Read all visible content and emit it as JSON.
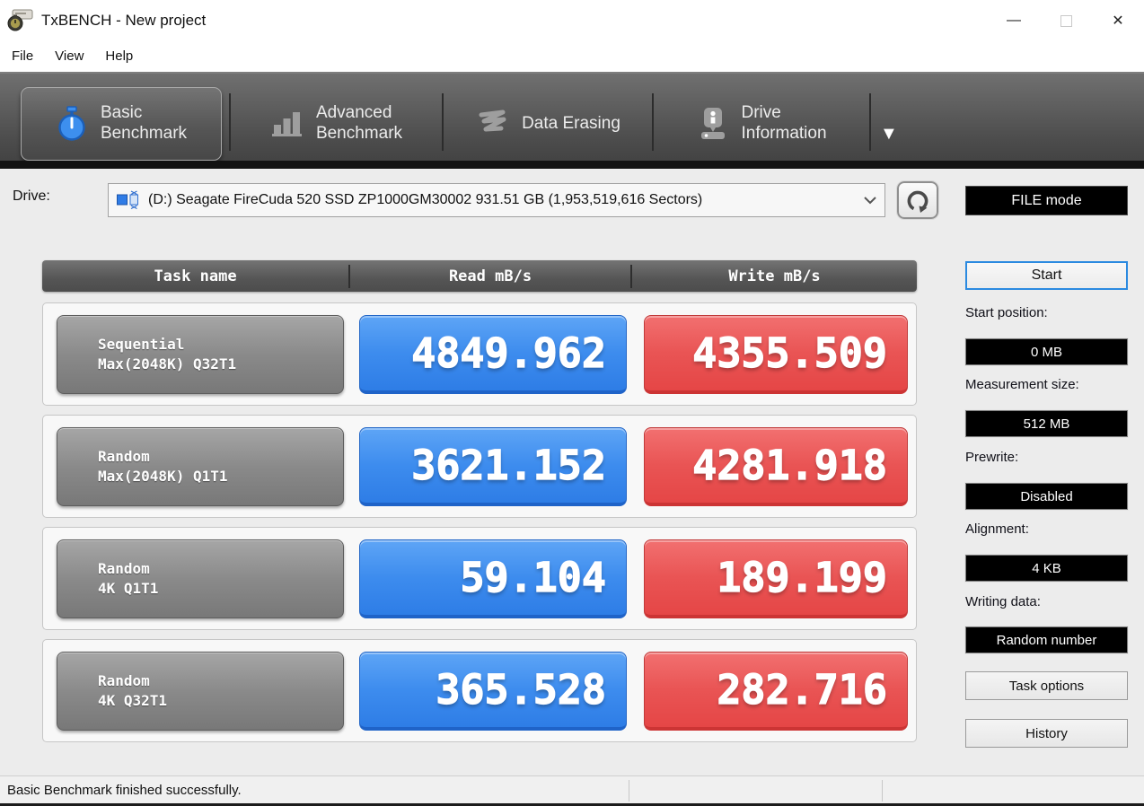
{
  "window": {
    "title": "TxBENCH - New project",
    "controls": {
      "minimize": "—",
      "close": "✕"
    }
  },
  "menu": {
    "items": [
      {
        "label": "File"
      },
      {
        "label": "View"
      },
      {
        "label": "Help"
      }
    ]
  },
  "tabs": {
    "items": [
      {
        "line1": "Basic",
        "line2": "Benchmark",
        "icon": "stopwatch-icon",
        "selected": true
      },
      {
        "line1": "Advanced",
        "line2": "Benchmark",
        "icon": "bar-chart-icon",
        "selected": false
      },
      {
        "line1": "Data Erasing",
        "line2": "",
        "icon": "eraser-icon",
        "selected": false
      },
      {
        "line1": "Drive",
        "line2": "Information",
        "icon": "drive-info-icon",
        "selected": false
      }
    ],
    "overflow_icon": "▼"
  },
  "drive": {
    "label": "Drive:",
    "selected": "(D:) Seagate FireCuda 520 SSD ZP1000GM30002  931.51 GB (1,953,519,616 Sectors)",
    "mode_badge": "FILE mode"
  },
  "table": {
    "headers": {
      "task": "Task name",
      "read": "Read mB/s",
      "write": "Write mB/s"
    },
    "rows": [
      {
        "task1": "Sequential",
        "task2": "Max(2048K) Q32T1",
        "read": "4849.962",
        "write": "4355.509"
      },
      {
        "task1": "Random",
        "task2": "Max(2048K) Q1T1",
        "read": "3621.152",
        "write": "4281.918"
      },
      {
        "task1": "Random",
        "task2": "4K Q1T1",
        "read": "59.104",
        "write": "189.199"
      },
      {
        "task1": "Random",
        "task2": "4K Q32T1",
        "read": "365.528",
        "write": "282.716"
      }
    ]
  },
  "sidebar": {
    "start_button": "Start",
    "fields": [
      {
        "label": "Start position:",
        "value": "0 MB"
      },
      {
        "label": "Measurement size:",
        "value": "512 MB"
      },
      {
        "label": "Prewrite:",
        "value": "Disabled"
      },
      {
        "label": "Alignment:",
        "value": "4 KB"
      },
      {
        "label": "Writing data:",
        "value": "Random number"
      }
    ],
    "task_options_button": "Task options",
    "history_button": "History"
  },
  "status": {
    "message": "Basic Benchmark finished successfully."
  },
  "colors": {
    "read_accent": "#3d8cee",
    "write_accent": "#e85050",
    "tab_icon_blue": "#3d8fee",
    "start_focus_border": "#2b8ae0",
    "badge_bg": "#000000"
  }
}
